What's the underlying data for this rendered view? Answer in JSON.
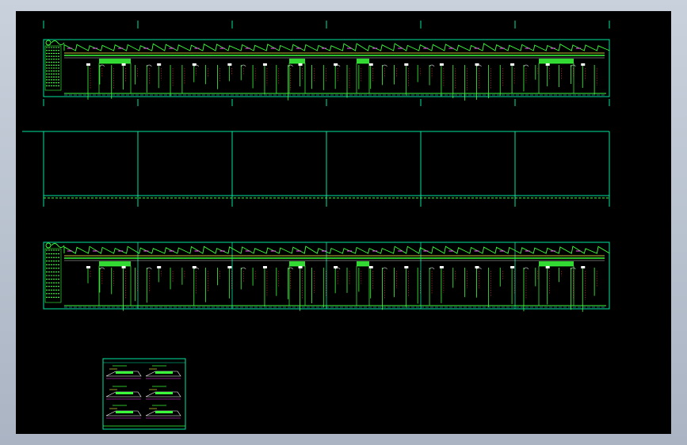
{
  "app": {
    "view_name": "cad-model-space"
  },
  "colors": {
    "background": "#000000",
    "frame": "#b9c2cf",
    "sheet_border": "#00e5a0",
    "profile_green": "#3cff3c",
    "annotation_magenta": "#ff4dff",
    "annotation_yellow": "#ffff4d",
    "annotation_red": "#ff3030",
    "annotation_cyan": "#40e0ff",
    "annotation_white": "#ffffff"
  },
  "drawing": {
    "sheet_columns": 6,
    "upper_profile": {
      "stations": 42,
      "columns": 44
    },
    "middle_blank_sheets": {
      "sheets": 6
    },
    "lower_profile": {
      "stations": 42,
      "columns": 44
    },
    "detail_sheet": {
      "details": 6
    }
  }
}
